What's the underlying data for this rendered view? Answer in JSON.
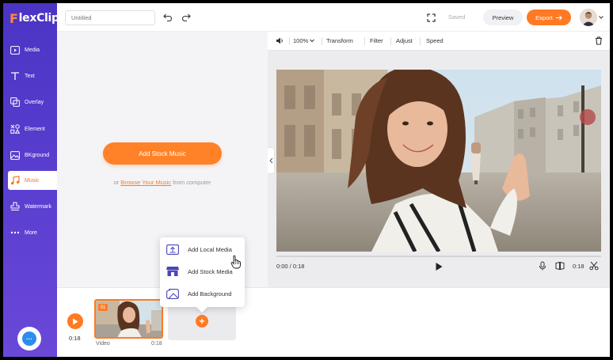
{
  "app": {
    "logo_letter": "F",
    "logo_rest": "lexClip"
  },
  "sidebar": {
    "items": [
      {
        "label": "Media",
        "icon": "media-icon"
      },
      {
        "label": "Text",
        "icon": "text-icon"
      },
      {
        "label": "Overlay",
        "icon": "overlay-icon"
      },
      {
        "label": "Element",
        "icon": "element-icon"
      },
      {
        "label": "BKground",
        "icon": "background-icon"
      },
      {
        "label": "Music",
        "icon": "music-icon",
        "active": true
      },
      {
        "label": "Watermark",
        "icon": "watermark-icon"
      },
      {
        "label": "More",
        "icon": "more-icon"
      }
    ],
    "chat_icon": "chat-icon"
  },
  "header": {
    "title_placeholder": "Untitled",
    "saved_label": "Saved",
    "preview_label": "Preview",
    "export_label": "Export"
  },
  "music_panel": {
    "add_stock_label": "Add Stock Music",
    "browse_prefix": "or",
    "browse_link": "Browse Your Music",
    "browse_suffix": "from computer"
  },
  "preview_toolbar": {
    "zoom": "100%",
    "transform": "Transform",
    "filter": "Filter",
    "adjust": "Adjust",
    "speed": "Speed"
  },
  "player": {
    "current_time": "0:00 / 0:18",
    "duration": "0:18",
    "progress": 0
  },
  "timeline": {
    "total_time": "0:18",
    "clip_number": "01",
    "clip_label": "Video",
    "clip_duration": "0:18"
  },
  "add_menu": {
    "items": [
      {
        "label": "Add Local Media",
        "icon": "upload-icon"
      },
      {
        "label": "Add Stock Media",
        "icon": "store-icon"
      },
      {
        "label": "Add Background",
        "icon": "background-icon"
      }
    ]
  },
  "colors": {
    "sidebar": "#5b3fd0",
    "accent": "#ff7a23"
  }
}
